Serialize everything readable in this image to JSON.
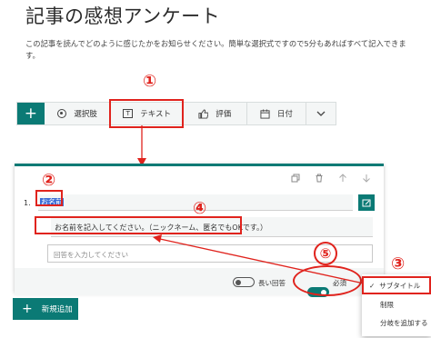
{
  "page": {
    "title": "記事の感想アンケート",
    "description": "この記事を読んでどのように感じたかをお知らせください。簡単な選択式ですので5分もあればすべて記入できます。"
  },
  "toolbar": {
    "add_icon": "plus-icon",
    "choice_label": "選択肢",
    "text_label": "テキスト",
    "rating_label": "評価",
    "date_label": "日付"
  },
  "question": {
    "number": "1.",
    "title": "お名前",
    "subtitle": "お名前を記入してください。（ニックネーム、匿名でもOKです。）",
    "answer_placeholder": "回答を入力してください",
    "long_answer_label": "長い回答",
    "required_label": "必須",
    "long_answer_on": false,
    "required_on": true
  },
  "more_menu": {
    "items": [
      "サブタイトル",
      "制限",
      "分岐を追加する"
    ],
    "checked_index": 0
  },
  "add_new_label": "新規追加",
  "annotations": {
    "step1": "①",
    "step2": "②",
    "step3": "③",
    "step4": "④",
    "step5": "⑤"
  },
  "colors": {
    "accent": "#0b7a75",
    "annotation": "#e0231d",
    "selection": "#3c6dd6"
  }
}
